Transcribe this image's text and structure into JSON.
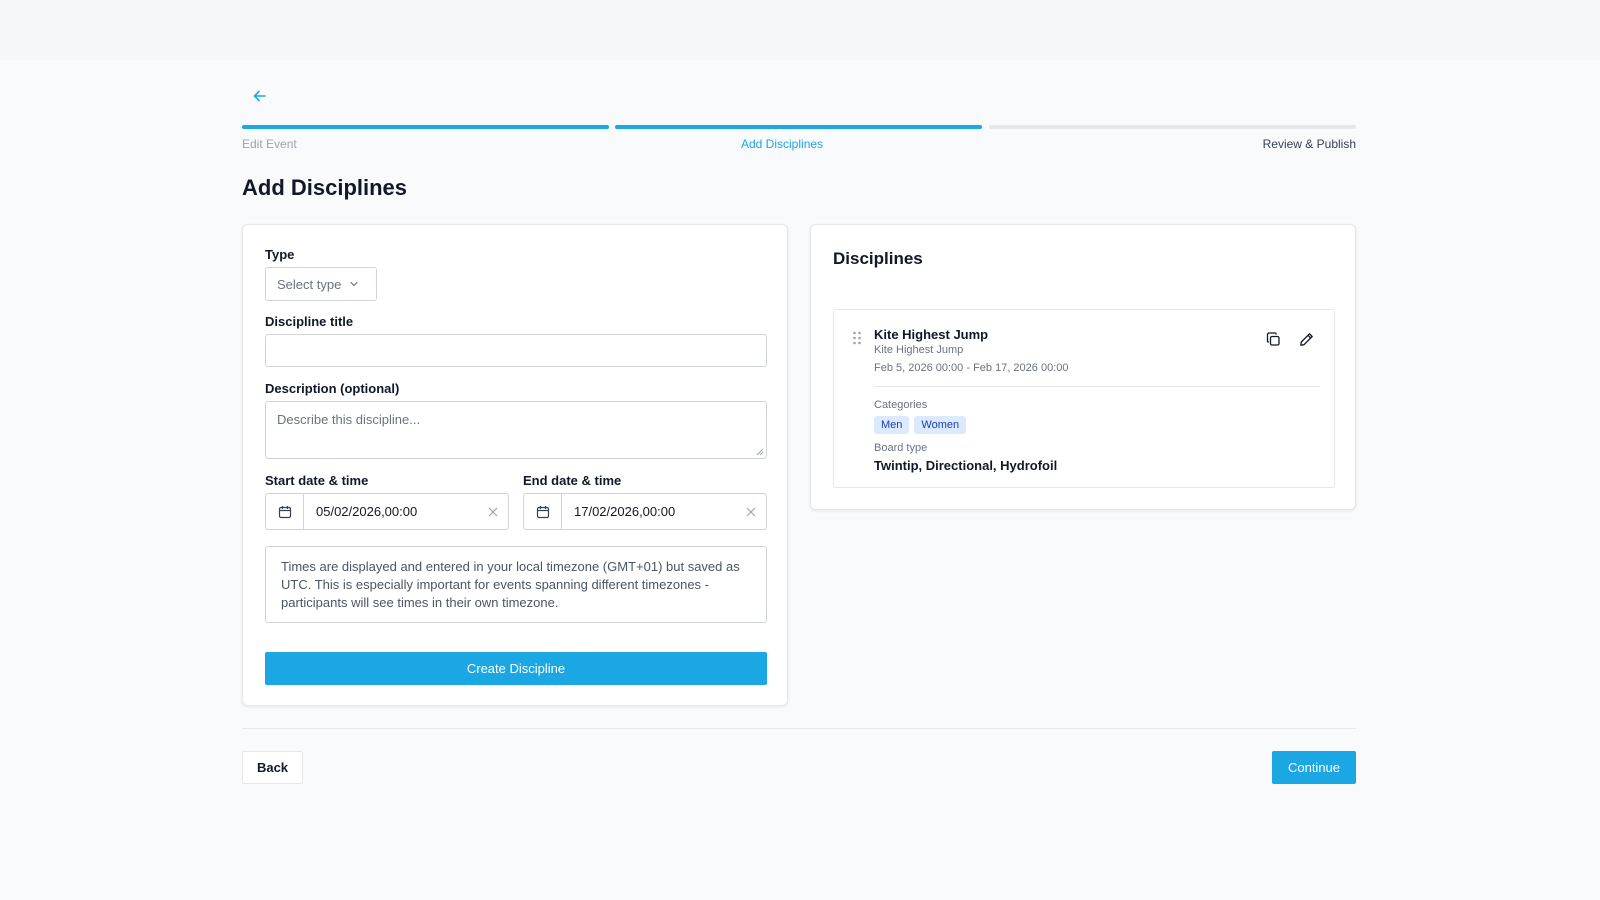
{
  "colors": {
    "accent": "#1ba7e4",
    "step_inactive": "#e5e7eb",
    "chip_bg": "#dbeafe",
    "chip_text": "#1e40af"
  },
  "header": {
    "back_icon": "arrow-left-icon"
  },
  "steps": [
    {
      "label": "Edit Event",
      "state": "complete"
    },
    {
      "label": "Add Disciplines",
      "state": "active"
    },
    {
      "label": "Review & Publish",
      "state": "upcoming"
    }
  ],
  "page_title": "Add Disciplines",
  "form": {
    "type_label": "Type",
    "type_placeholder": "Select type",
    "title_label": "Discipline title",
    "title_value": "",
    "description_label": "Description (optional)",
    "description_placeholder": "Describe this discipline...",
    "start_label": "Start date & time",
    "start_value": "05/02/2026,00:00",
    "end_label": "End date & time",
    "end_value": "17/02/2026,00:00",
    "timezone_note": "Times are displayed and entered in your local timezone (GMT+01) but saved as UTC. This is especially important for events spanning different timezones - participants will see times in their own timezone.",
    "create_label": "Create Discipline"
  },
  "disciplines": {
    "title": "Disciplines",
    "items": [
      {
        "title": "Kite Highest Jump",
        "subtitle": "Kite Highest Jump",
        "dates": "Feb 5, 2026 00:00 - Feb 17, 2026 00:00",
        "categories_label": "Categories",
        "categories": [
          "Men",
          "Women"
        ],
        "board_type_label": "Board type",
        "board_type": "Twintip, Directional, Hydrofoil"
      }
    ]
  },
  "footer": {
    "back_label": "Back",
    "continue_label": "Continue"
  }
}
